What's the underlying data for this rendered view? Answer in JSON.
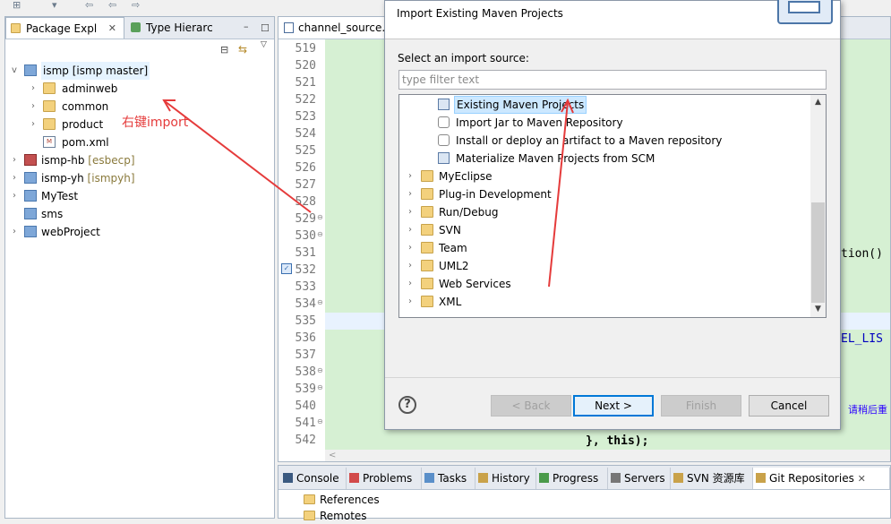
{
  "left_view": {
    "tabs": [
      {
        "label": "Package Expl",
        "close": "✕"
      },
      {
        "label": "Type Hierarc"
      }
    ],
    "tree": [
      {
        "name": "ismp",
        "branch": "[ismp master]",
        "expanded": true,
        "icon": "project-icon"
      },
      {
        "name": "adminweb",
        "icon": "folder-icon"
      },
      {
        "name": "common",
        "icon": "folder-icon"
      },
      {
        "name": "product",
        "icon": "folder-icon"
      },
      {
        "name": "pom.xml",
        "icon": "xml-file-icon",
        "badge": "M"
      },
      {
        "name": "ismp-hb",
        "branch": "[esbecp]",
        "icon": "project-icon"
      },
      {
        "name": "ismp-yh",
        "branch": "[ismpyh]",
        "icon": "project-icon"
      },
      {
        "name": "MyTest",
        "icon": "project-icon"
      },
      {
        "name": "sms",
        "icon": "project-icon"
      },
      {
        "name": "webProject",
        "icon": "project-icon"
      }
    ]
  },
  "editor": {
    "tab_label": "channel_source.j",
    "line_numbers": [
      "519",
      "520",
      "521",
      "522",
      "523",
      "524",
      "525",
      "526",
      "527",
      "528",
      "529",
      "530",
      "531",
      "532",
      "533",
      "534",
      "535",
      "536",
      "537",
      "538",
      "539",
      "540",
      "541",
      "542"
    ],
    "code_fragments": {
      "l531": "tion() {",
      "l536": "EL_LIS",
      "l540": "请稍后重",
      "l542": "}, this);"
    },
    "scroll_arrow": "<"
  },
  "bottom_panel": {
    "tabs": [
      "Console",
      "Problems",
      "Tasks",
      "History",
      "Progress",
      "Servers",
      "SVN 资源库",
      "Git Repositories"
    ],
    "close": "✕",
    "items": [
      "References",
      "Remotes"
    ]
  },
  "dialog": {
    "title": "Import Existing Maven Projects",
    "source_label": "Select an import source:",
    "filter_placeholder": "type filter text",
    "tree": [
      {
        "label": "Existing Maven Projects",
        "selected": true,
        "child": true
      },
      {
        "label": "Import Jar to Maven Repository",
        "child": true
      },
      {
        "label": "Install or deploy an artifact to a Maven repository",
        "child": true
      },
      {
        "label": "Materialize Maven Projects from SCM",
        "child": true
      },
      {
        "label": "MyEclipse"
      },
      {
        "label": "Plug-in Development"
      },
      {
        "label": "Run/Debug"
      },
      {
        "label": "SVN"
      },
      {
        "label": "Team"
      },
      {
        "label": "UML2"
      },
      {
        "label": "Web Services"
      },
      {
        "label": "XML"
      }
    ],
    "scroll_up": "▲",
    "scroll_down": "▼",
    "help": "?",
    "buttons": {
      "back": "< Back",
      "next": "Next >",
      "finish": "Finish",
      "cancel": "Cancel"
    }
  },
  "annotation": {
    "text": "右键import",
    "color": "#e53b3b"
  }
}
